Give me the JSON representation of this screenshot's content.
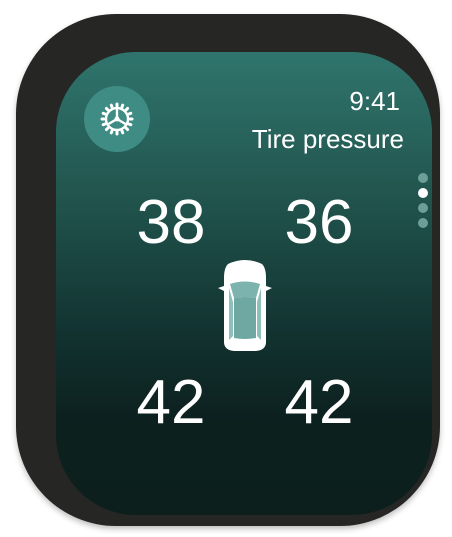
{
  "status": {
    "time": "9:41"
  },
  "header": {
    "title": "Tire pressure",
    "settings_icon": "gear-steering-wheel-icon"
  },
  "tires": {
    "front_left": "38",
    "front_right": "36",
    "rear_left": "42",
    "rear_right": "42"
  },
  "page_indicator": {
    "count": 4,
    "active_index": 1
  },
  "colors": {
    "accent": "#3e8c84",
    "background_top": "#2f756d",
    "background_bottom": "#0c1f1d"
  }
}
